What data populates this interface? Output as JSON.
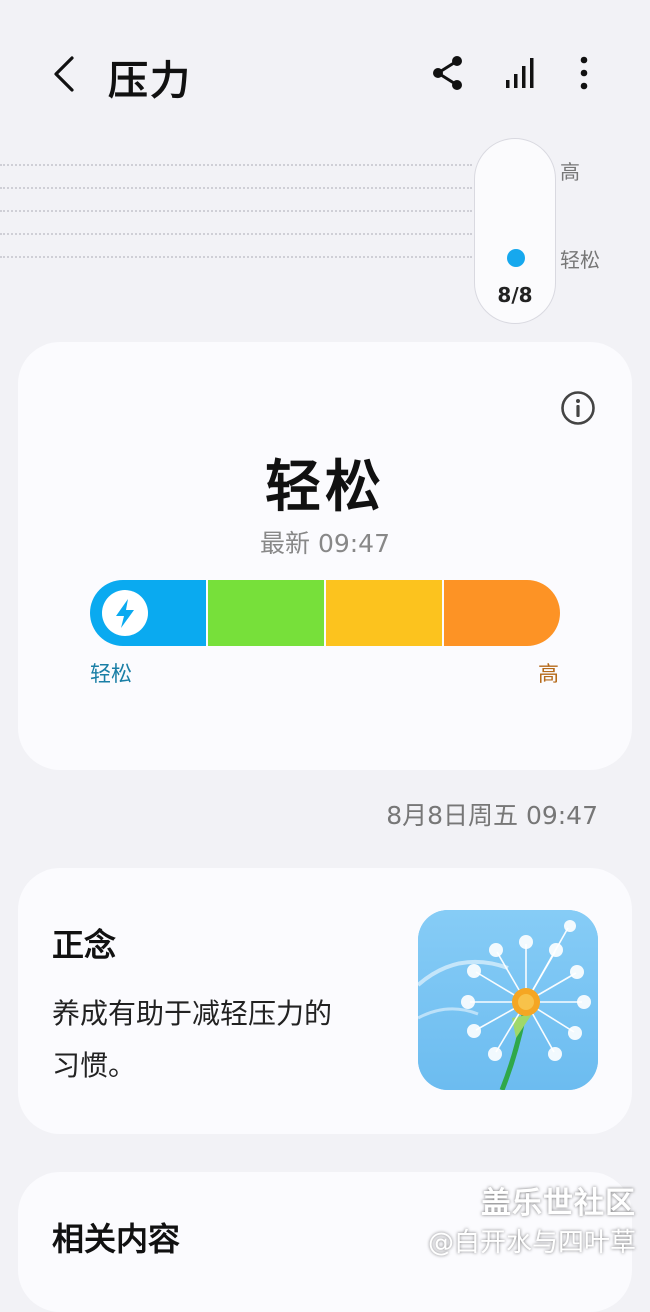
{
  "header": {
    "title": "压力",
    "icons": [
      "back-icon",
      "share-icon",
      "chart-icon",
      "more-icon"
    ]
  },
  "trend": {
    "scale_high": "高",
    "scale_low": "轻松",
    "selected_date": "8/8"
  },
  "stress_card": {
    "state": "轻松",
    "latest": "最新 09:47",
    "scale_low_label": "轻松",
    "scale_high_label": "高",
    "segment_colors": [
      "#0aaaf0",
      "#77e03a",
      "#fcc31e",
      "#fd9325"
    ],
    "current_level": 0.08
  },
  "timestamp": "8月8日周五 09:47",
  "mindfulness": {
    "title": "正念",
    "description": "养成有助于减轻压力的习惯。"
  },
  "related": {
    "title": "相关内容"
  },
  "watermark": {
    "line1": "盖乐世社区",
    "line2": "@白开水与四叶草"
  }
}
